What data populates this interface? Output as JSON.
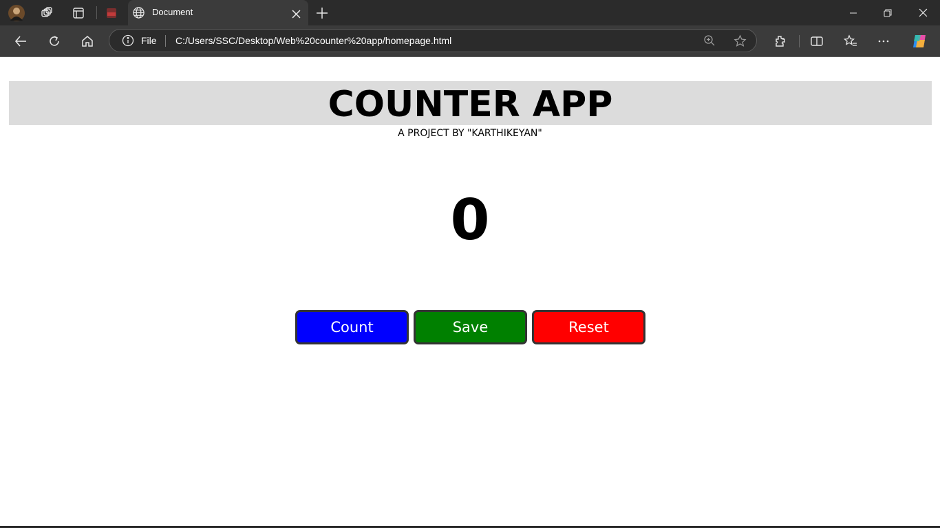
{
  "browser": {
    "tab_title": "Document",
    "address_scheme_label": "File",
    "address_url": "C:/Users/SSC/Desktop/Web%20counter%20app/homepage.html"
  },
  "app": {
    "title": "COUNTER APP",
    "subtitle": "A PROJECT BY \"KARTHIKEYAN\"",
    "count_value": "0"
  },
  "buttons": {
    "count": {
      "label": "Count",
      "color": "#0000ff"
    },
    "save": {
      "label": "Save",
      "color": "#008000"
    },
    "reset": {
      "label": "Reset",
      "color": "#ff0000"
    }
  },
  "colors": {
    "header_band": "#dcdcdc",
    "chrome_dark": "#2b2b2b",
    "chrome_mid": "#3b3b3b"
  }
}
